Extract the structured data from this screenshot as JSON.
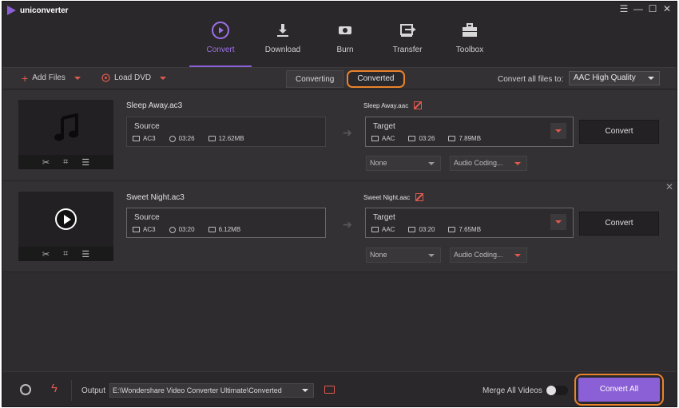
{
  "app": {
    "title": "uniconverter"
  },
  "window_controls": [
    "☰",
    "—",
    "☐",
    "✕"
  ],
  "nav": {
    "tabs": [
      {
        "label": "Convert",
        "icon": "convert-icon",
        "active": true
      },
      {
        "label": "Download",
        "icon": "download-icon",
        "active": false
      },
      {
        "label": "Burn",
        "icon": "burn-icon",
        "active": false
      },
      {
        "label": "Transfer",
        "icon": "transfer-icon",
        "active": false
      },
      {
        "label": "Toolbox",
        "icon": "toolbox-icon",
        "active": false
      }
    ]
  },
  "toolbar": {
    "add_files": "Add Files",
    "load_dvd": "Load DVD",
    "tab_converting": "Converting",
    "tab_converted": "Converted",
    "convert_all_label": "Convert all files to:",
    "format_value": "AAC High Quality"
  },
  "files": [
    {
      "name": "Sleep Away.ac3",
      "source_label": "Source",
      "source_format": "AC3",
      "source_duration": "03:26",
      "source_size": "12.62MB",
      "target_name": "Sleep Away.aac",
      "target_label": "Target",
      "target_format": "AAC",
      "target_duration": "03:26",
      "target_size": "7.89MB",
      "convert_label": "Convert",
      "subtitle": "None",
      "audio": "Audio Coding..."
    },
    {
      "name": "Sweet Night.ac3",
      "source_label": "Source",
      "source_format": "AC3",
      "source_duration": "03:20",
      "source_size": "6.12MB",
      "target_name": "Sweet Night.aac",
      "target_label": "Target",
      "target_format": "AAC",
      "target_duration": "03:20",
      "target_size": "7.65MB",
      "convert_label": "Convert",
      "subtitle": "None",
      "audio": "Audio Coding..."
    }
  ],
  "bottom": {
    "output_label": "Output",
    "output_path": "E:\\Wondershare Video Converter Ultimate\\Converted",
    "merge_label": "Merge All Videos",
    "convert_all": "Convert All"
  },
  "colors": {
    "accent": "#8b5fd6",
    "highlight": "#e8832b",
    "icon_red": "#e05a4e"
  }
}
